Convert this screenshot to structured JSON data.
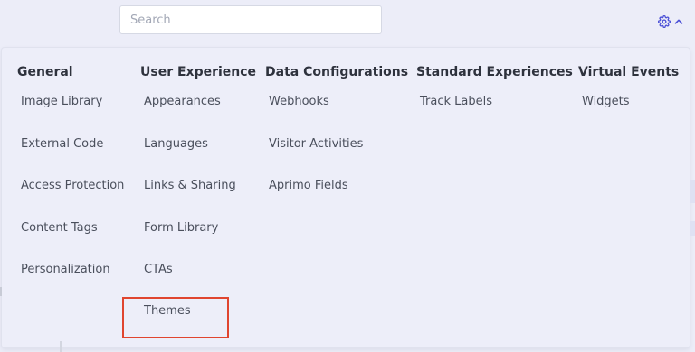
{
  "search": {
    "placeholder": "Search",
    "value": ""
  },
  "settings": {
    "icon": "gear-icon",
    "toggle_icon": "chevron-up-icon",
    "accent_color": "#4a4fd6"
  },
  "menu": {
    "columns": [
      {
        "heading": "General",
        "items": [
          "Image Library",
          "External Code",
          "Access Protection",
          "Content Tags",
          "Personalization"
        ]
      },
      {
        "heading": "User Experience",
        "items": [
          "Appearances",
          "Languages",
          "Links & Sharing",
          "Form Library",
          "CTAs",
          "Themes"
        ]
      },
      {
        "heading": "Data Configurations",
        "items": [
          "Webhooks",
          "Visitor Activities",
          "Aprimo Fields"
        ]
      },
      {
        "heading": "Standard Experiences",
        "items": [
          "Track Labels"
        ]
      },
      {
        "heading": "Virtual Events",
        "items": [
          "Widgets"
        ]
      }
    ],
    "highlighted_item": "Themes",
    "highlight_color": "#e0452f"
  }
}
